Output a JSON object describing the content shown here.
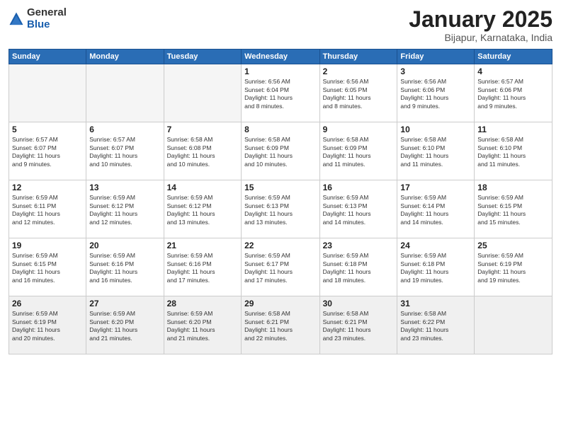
{
  "logo": {
    "general": "General",
    "blue": "Blue"
  },
  "title": {
    "month": "January 2025",
    "location": "Bijapur, Karnataka, India"
  },
  "weekdays": [
    "Sunday",
    "Monday",
    "Tuesday",
    "Wednesday",
    "Thursday",
    "Friday",
    "Saturday"
  ],
  "weeks": [
    [
      {
        "day": "",
        "info": ""
      },
      {
        "day": "",
        "info": ""
      },
      {
        "day": "",
        "info": ""
      },
      {
        "day": "1",
        "info": "Sunrise: 6:56 AM\nSunset: 6:04 PM\nDaylight: 11 hours\nand 8 minutes."
      },
      {
        "day": "2",
        "info": "Sunrise: 6:56 AM\nSunset: 6:05 PM\nDaylight: 11 hours\nand 8 minutes."
      },
      {
        "day": "3",
        "info": "Sunrise: 6:56 AM\nSunset: 6:06 PM\nDaylight: 11 hours\nand 9 minutes."
      },
      {
        "day": "4",
        "info": "Sunrise: 6:57 AM\nSunset: 6:06 PM\nDaylight: 11 hours\nand 9 minutes."
      }
    ],
    [
      {
        "day": "5",
        "info": "Sunrise: 6:57 AM\nSunset: 6:07 PM\nDaylight: 11 hours\nand 9 minutes."
      },
      {
        "day": "6",
        "info": "Sunrise: 6:57 AM\nSunset: 6:07 PM\nDaylight: 11 hours\nand 10 minutes."
      },
      {
        "day": "7",
        "info": "Sunrise: 6:58 AM\nSunset: 6:08 PM\nDaylight: 11 hours\nand 10 minutes."
      },
      {
        "day": "8",
        "info": "Sunrise: 6:58 AM\nSunset: 6:09 PM\nDaylight: 11 hours\nand 10 minutes."
      },
      {
        "day": "9",
        "info": "Sunrise: 6:58 AM\nSunset: 6:09 PM\nDaylight: 11 hours\nand 11 minutes."
      },
      {
        "day": "10",
        "info": "Sunrise: 6:58 AM\nSunset: 6:10 PM\nDaylight: 11 hours\nand 11 minutes."
      },
      {
        "day": "11",
        "info": "Sunrise: 6:58 AM\nSunset: 6:10 PM\nDaylight: 11 hours\nand 11 minutes."
      }
    ],
    [
      {
        "day": "12",
        "info": "Sunrise: 6:59 AM\nSunset: 6:11 PM\nDaylight: 11 hours\nand 12 minutes."
      },
      {
        "day": "13",
        "info": "Sunrise: 6:59 AM\nSunset: 6:12 PM\nDaylight: 11 hours\nand 12 minutes."
      },
      {
        "day": "14",
        "info": "Sunrise: 6:59 AM\nSunset: 6:12 PM\nDaylight: 11 hours\nand 13 minutes."
      },
      {
        "day": "15",
        "info": "Sunrise: 6:59 AM\nSunset: 6:13 PM\nDaylight: 11 hours\nand 13 minutes."
      },
      {
        "day": "16",
        "info": "Sunrise: 6:59 AM\nSunset: 6:13 PM\nDaylight: 11 hours\nand 14 minutes."
      },
      {
        "day": "17",
        "info": "Sunrise: 6:59 AM\nSunset: 6:14 PM\nDaylight: 11 hours\nand 14 minutes."
      },
      {
        "day": "18",
        "info": "Sunrise: 6:59 AM\nSunset: 6:15 PM\nDaylight: 11 hours\nand 15 minutes."
      }
    ],
    [
      {
        "day": "19",
        "info": "Sunrise: 6:59 AM\nSunset: 6:15 PM\nDaylight: 11 hours\nand 16 minutes."
      },
      {
        "day": "20",
        "info": "Sunrise: 6:59 AM\nSunset: 6:16 PM\nDaylight: 11 hours\nand 16 minutes."
      },
      {
        "day": "21",
        "info": "Sunrise: 6:59 AM\nSunset: 6:16 PM\nDaylight: 11 hours\nand 17 minutes."
      },
      {
        "day": "22",
        "info": "Sunrise: 6:59 AM\nSunset: 6:17 PM\nDaylight: 11 hours\nand 17 minutes."
      },
      {
        "day": "23",
        "info": "Sunrise: 6:59 AM\nSunset: 6:18 PM\nDaylight: 11 hours\nand 18 minutes."
      },
      {
        "day": "24",
        "info": "Sunrise: 6:59 AM\nSunset: 6:18 PM\nDaylight: 11 hours\nand 19 minutes."
      },
      {
        "day": "25",
        "info": "Sunrise: 6:59 AM\nSunset: 6:19 PM\nDaylight: 11 hours\nand 19 minutes."
      }
    ],
    [
      {
        "day": "26",
        "info": "Sunrise: 6:59 AM\nSunset: 6:19 PM\nDaylight: 11 hours\nand 20 minutes."
      },
      {
        "day": "27",
        "info": "Sunrise: 6:59 AM\nSunset: 6:20 PM\nDaylight: 11 hours\nand 21 minutes."
      },
      {
        "day": "28",
        "info": "Sunrise: 6:59 AM\nSunset: 6:20 PM\nDaylight: 11 hours\nand 21 minutes."
      },
      {
        "day": "29",
        "info": "Sunrise: 6:58 AM\nSunset: 6:21 PM\nDaylight: 11 hours\nand 22 minutes."
      },
      {
        "day": "30",
        "info": "Sunrise: 6:58 AM\nSunset: 6:21 PM\nDaylight: 11 hours\nand 23 minutes."
      },
      {
        "day": "31",
        "info": "Sunrise: 6:58 AM\nSunset: 6:22 PM\nDaylight: 11 hours\nand 23 minutes."
      },
      {
        "day": "",
        "info": ""
      }
    ]
  ]
}
